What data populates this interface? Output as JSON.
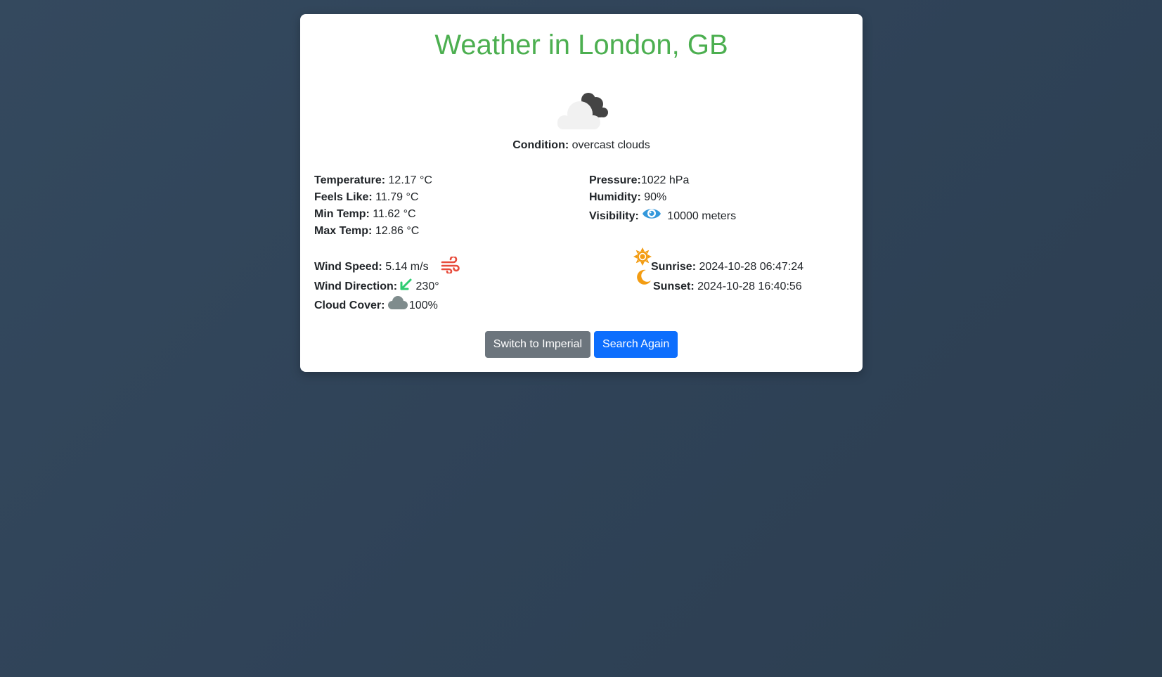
{
  "header": {
    "title": "Weather in London, GB"
  },
  "icons": {
    "weather": "overcast-clouds-icon",
    "visibility": "eye-icon",
    "wind": "wind-icon",
    "wind_direction": "arrow-down-left-icon",
    "cloud_cover": "cloud-icon",
    "sunrise": "sun-icon",
    "sunset": "moon-icon"
  },
  "colors": {
    "title": "#4caf50",
    "wind_icon": "#e74c3c",
    "direction_icon": "#2ecc71",
    "eye_icon": "#3498db",
    "cloud_icon": "#7f8c8d",
    "sun_moon_icon": "#f39c12",
    "imperial_button": "#6c757d",
    "search_button": "#0d6efd"
  },
  "condition": {
    "label": "Condition:",
    "value": "overcast clouds"
  },
  "temps": {
    "temperature": {
      "label": "Temperature:",
      "value": "12.17 °C"
    },
    "feels_like": {
      "label": "Feels Like:",
      "value": "11.79 °C"
    },
    "min_temp": {
      "label": "Min Temp:",
      "value": "11.62 °C"
    },
    "max_temp": {
      "label": "Max Temp:",
      "value": "12.86 °C"
    }
  },
  "atmos": {
    "pressure": {
      "label": "Pressure:",
      "value": "1022 hPa"
    },
    "humidity": {
      "label": "Humidity:",
      "value": "90%"
    },
    "visibility": {
      "label": "Visibility:",
      "value": "10000 meters"
    }
  },
  "wind": {
    "speed": {
      "label": "Wind Speed:",
      "value": "5.14 m/s"
    },
    "direction": {
      "label": "Wind Direction:",
      "value": "230°"
    },
    "cloud_cover": {
      "label": "Cloud Cover:",
      "value": "100%"
    }
  },
  "sun": {
    "sunrise": {
      "label": "Sunrise:",
      "value": "2024-10-28 06:47:24"
    },
    "sunset": {
      "label": "Sunset:",
      "value": "2024-10-28 16:40:56"
    }
  },
  "buttons": {
    "imperial": "Switch to Imperial",
    "search": "Search Again"
  }
}
